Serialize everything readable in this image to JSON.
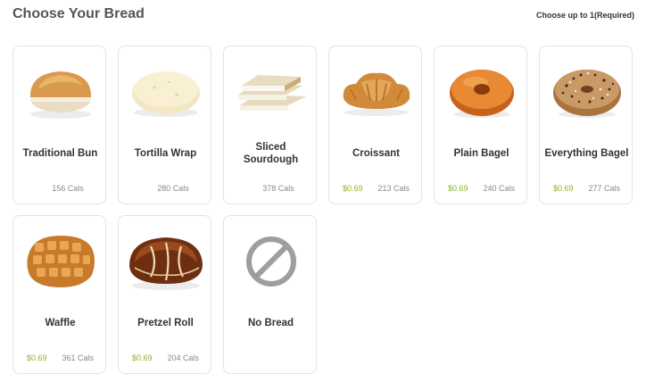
{
  "header": {
    "title": "Choose Your Bread",
    "hint": "Choose up to 1(Required)"
  },
  "items": [
    {
      "name": "Traditional Bun",
      "price": "",
      "cals": "156 Cals",
      "icon": "bun-image"
    },
    {
      "name": "Tortilla Wrap",
      "price": "",
      "cals": "280 Cals",
      "icon": "tortilla-image"
    },
    {
      "name": "Sliced\nSourdough",
      "price": "",
      "cals": "378 Cals",
      "icon": "sourdough-image"
    },
    {
      "name": "Croissant",
      "price": "$0.69",
      "cals": "213 Cals",
      "icon": "croissant-image"
    },
    {
      "name": "Plain Bagel",
      "price": "$0.69",
      "cals": "240 Cals",
      "icon": "plain-bagel-image"
    },
    {
      "name": "Everything Bagel",
      "price": "$0.69",
      "cals": "277 Cals",
      "icon": "everything-bagel-image"
    },
    {
      "name": "Waffle",
      "price": "$0.69",
      "cals": "361 Cals",
      "icon": "waffle-image"
    },
    {
      "name": "Pretzel Roll",
      "price": "$0.69",
      "cals": "204 Cals",
      "icon": "pretzel-roll-image"
    },
    {
      "name": "No Bread",
      "price": "",
      "cals": "",
      "icon": "no-symbol-icon"
    }
  ],
  "colors": {
    "price": "#8ab32b",
    "calories": "#888888",
    "card_border": "#e3e3e3"
  }
}
